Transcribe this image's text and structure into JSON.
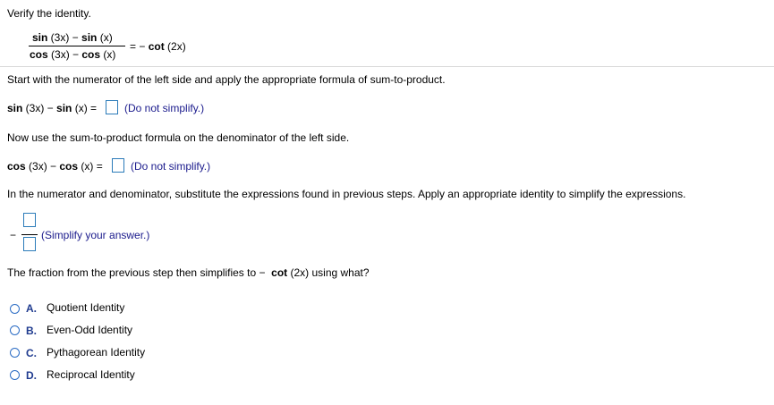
{
  "prompt": "Verify the identity.",
  "identity": {
    "numerator_a": "sin",
    "numerator_a_arg": " (3x)",
    "numerator_minus": " − ",
    "numerator_b": "sin",
    "numerator_b_arg": " (x)",
    "denominator_a": "cos",
    "denominator_a_arg": " (3x)",
    "denominator_minus": " − ",
    "denominator_b": "cos",
    "denominator_b_arg": " (x)",
    "equals": "= −",
    "rhs_func": "cot",
    "rhs_arg": " (2x)"
  },
  "step1": {
    "instruction": "Start with the numerator of the left side and apply the appropriate formula of sum-to-product.",
    "lhs_a": "sin",
    "lhs_a_arg": " (3x) − ",
    "lhs_b": "sin",
    "lhs_b_arg": " (x) =",
    "hint": "(Do not simplify.)"
  },
  "step2": {
    "instruction": "Now use the sum-to-product formula on the denominator of the left side.",
    "lhs_a": "cos",
    "lhs_a_arg": " (3x) − ",
    "lhs_b": "cos",
    "lhs_b_arg": " (x) =",
    "hint": "(Do not simplify.)"
  },
  "step3": {
    "instruction": "In the numerator and denominator, substitute the expressions found in previous steps. Apply an appropriate identity to simplify the expressions.",
    "minus": "−",
    "hint": "(Simplify your answer.)"
  },
  "question": {
    "text_before": "The fraction from the previous step then simplifies to ",
    "minus": "−",
    "func": "cot",
    "text_after": " (2x) using what?"
  },
  "options": [
    {
      "letter": "A.",
      "label": "Quotient Identity"
    },
    {
      "letter": "B.",
      "label": "Even-Odd Identity"
    },
    {
      "letter": "C.",
      "label": "Pythagorean Identity"
    },
    {
      "letter": "D.",
      "label": "Reciprocal Identity"
    }
  ],
  "colors": {
    "accent": "#2b6cc4",
    "hint": "#1a1a8c",
    "option_letter": "#1f3b8f"
  }
}
